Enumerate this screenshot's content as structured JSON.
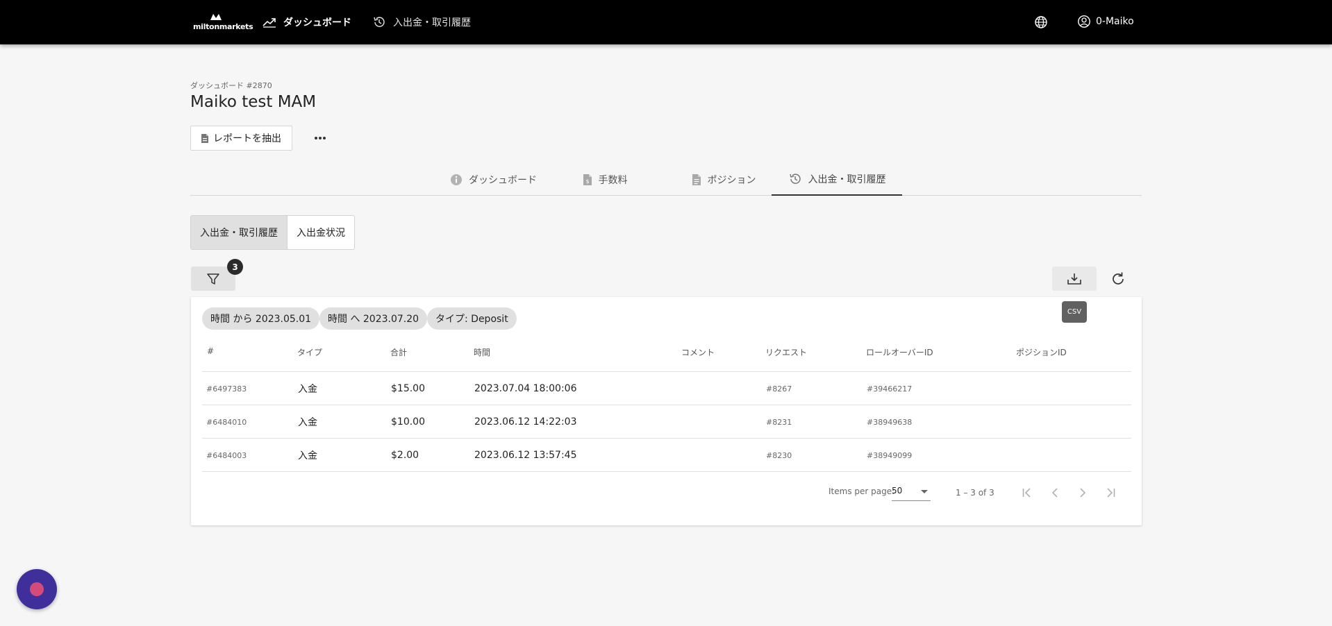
{
  "header": {
    "logo_text": "miltonmarkets",
    "nav": {
      "dashboard": "ダッシュボード",
      "history": "入出金・取引履歴"
    },
    "user": "0-Maiko"
  },
  "page": {
    "breadcrumb": "ダッシュボード #2870",
    "title": "Maiko test MAM",
    "report_button": "レポートを抽出"
  },
  "tabs": [
    {
      "label": "ダッシュボード",
      "icon": "info-icon"
    },
    {
      "label": "手数料",
      "icon": "fee-document-icon"
    },
    {
      "label": "ポジション",
      "icon": "document-icon"
    },
    {
      "label": "入出金・取引履歴",
      "icon": "history-icon",
      "active": true
    }
  ],
  "subtabs": [
    {
      "label": "入出金・取引履歴",
      "active": true
    },
    {
      "label": "入出金状況",
      "active": false
    }
  ],
  "filter": {
    "count": "3",
    "chips": [
      "時間 から 2023.05.01",
      "時間 へ 2023.07.20",
      "タイプ: Deposit"
    ]
  },
  "toolbar": {
    "csv_tooltip": "CSV"
  },
  "table": {
    "columns": [
      "#",
      "タイプ",
      "合計",
      "時間",
      "コメント",
      "リクエスト",
      "ロールオーバーID",
      "ポジションID"
    ],
    "rows": [
      {
        "id": "#6497383",
        "type": "入金",
        "amount": "$15.00",
        "time": "2023.07.04 18:00:06",
        "comment": "",
        "request": "#8267",
        "rollover": "#39466217",
        "position": ""
      },
      {
        "id": "#6484010",
        "type": "入金",
        "amount": "$10.00",
        "time": "2023.06.12 14:22:03",
        "comment": "",
        "request": "#8231",
        "rollover": "#38949638",
        "position": ""
      },
      {
        "id": "#6484003",
        "type": "入金",
        "amount": "$2.00",
        "time": "2023.06.12 13:57:45",
        "comment": "",
        "request": "#8230",
        "rollover": "#38949099",
        "position": ""
      }
    ]
  },
  "pagination": {
    "items_per_page_label": "Items per page:",
    "items_per_page": "50",
    "range": "1 – 3 of 3"
  },
  "colors": {
    "topbar": "#000000",
    "background": "#f6f6f6",
    "chat_button": "#3f2f9a",
    "chat_dot": "#d24b79"
  }
}
